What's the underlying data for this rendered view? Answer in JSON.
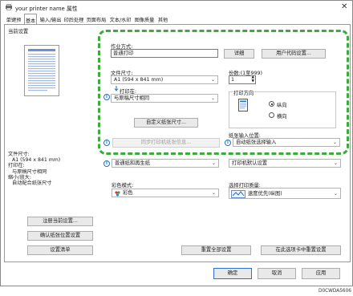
{
  "window": {
    "title": "your printer name 属性",
    "close_glyph": "✕"
  },
  "tabs": [
    {
      "label": "单键预设"
    },
    {
      "label": "基本"
    },
    {
      "label": "输入/输出"
    },
    {
      "label": "印后处理"
    },
    {
      "label": "页面布局"
    },
    {
      "label": "文本/水印"
    },
    {
      "label": "图像质量"
    },
    {
      "label": "其他"
    }
  ],
  "left_panel": {
    "current_setting_label": "当前设置",
    "summary": [
      "文件尺寸:",
      "A1 (594 x 841 mm)",
      "打印在:",
      "与原稿尺寸相同",
      "缩小/放大:",
      "自动配合纸张尺寸"
    ],
    "register_button": "注册当前设置...",
    "confirm_button": "确认纸张位置设置",
    "settings_list_button": "设置清单"
  },
  "main": {
    "job_type_label": "作业方式:",
    "job_type_value": "普通打印",
    "details_button": "详细",
    "user_code_button": "用户代码设置...",
    "doc_size_label": "文件尺寸:",
    "doc_size_value": "A1 (594 x 841 mm)",
    "copies_label": "份数:(1至999)",
    "copies_value": "1",
    "print_on_label": "打印在:",
    "print_on_value": "与原稿尺寸相同",
    "orientation_label": "打印方向",
    "portrait_label": "纵向",
    "landscape_label": "横向",
    "custom_size_button": "自定义纸张尺寸...",
    "paper_source_label": "纸张输入位置:",
    "paper_source_value": "自动纸张选择输入",
    "sync_button": "同步打印机纸张信息...",
    "paper_type_value": "普通纸和再生纸",
    "printer_default_value": "打印机默认设置",
    "color_mode_label": "彩色模式:",
    "color_mode_value": "彩色",
    "print_quality_label": "选择打印质量:",
    "print_quality_value": "速度优先(纵图)",
    "reset_button": "重置全部设置",
    "printer_settings_button": "在此选项卡中重置设置"
  },
  "footer": {
    "ok_button": "确定",
    "cancel_button": "取消",
    "apply_button": "应用",
    "figure_id": "D0CWDA5606"
  },
  "colors": {
    "highlight_dashed": "#3cab3c",
    "info_icon": "#1f6fc4"
  }
}
